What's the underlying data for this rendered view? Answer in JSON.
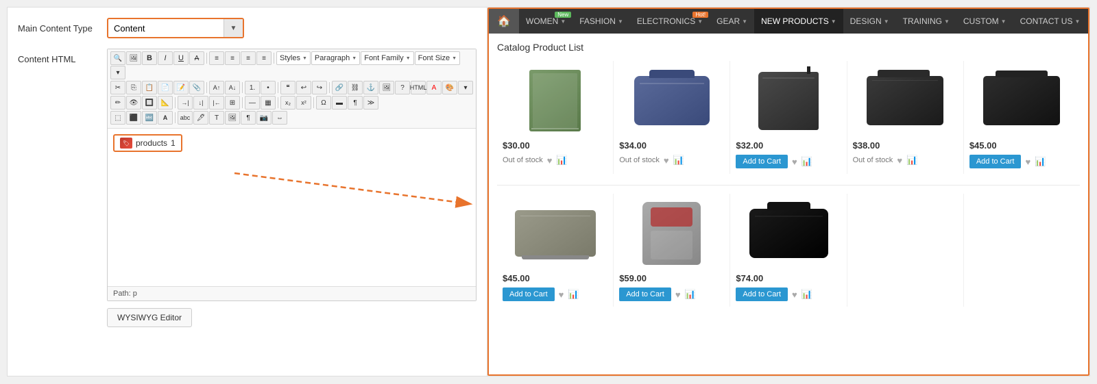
{
  "left": {
    "content_type_label": "Main Content Type",
    "content_type_value": "Content",
    "content_html_label": "Content HTML",
    "path_label": "Path: p",
    "wysiwyg_button": "WYSIWYG Editor",
    "products_widget_label": "products",
    "products_widget_count": "1",
    "toolbar": {
      "row1": {
        "styles_label": "Styles",
        "paragraph_label": "Paragraph",
        "font_family_label": "Font Family",
        "font_size_label": "Font Size"
      }
    }
  },
  "right": {
    "nav": {
      "home_icon": "🏠",
      "items": [
        {
          "label": "WOMEN",
          "badge": "New",
          "badge_type": "new",
          "has_arrow": true
        },
        {
          "label": "FASHION",
          "has_arrow": true
        },
        {
          "label": "ELECTRONICS",
          "badge": "Hot!",
          "badge_type": "hot",
          "has_arrow": true
        },
        {
          "label": "GEAR",
          "has_arrow": true
        },
        {
          "label": "NEW PRODUCTS",
          "active": true,
          "has_arrow": true
        },
        {
          "label": "DESIGN",
          "has_arrow": true
        },
        {
          "label": "TRAINING",
          "has_arrow": true
        },
        {
          "label": "CUSTOM",
          "has_arrow": true
        },
        {
          "label": "CONTACT US",
          "has_arrow": true
        }
      ]
    },
    "catalog_title": "Catalog Product List",
    "products_row1": [
      {
        "price": "$30.00",
        "status": "Out of stock",
        "has_add_to_cart": false,
        "shape": "book"
      },
      {
        "price": "$34.00",
        "status": "Out of stock",
        "has_add_to_cart": false,
        "shape": "duffel-navy"
      },
      {
        "price": "$32.00",
        "status": "",
        "has_add_to_cart": true,
        "add_to_cart_label": "Add to Cart",
        "shape": "sling"
      },
      {
        "price": "$38.00",
        "status": "Out of stock",
        "has_add_to_cart": false,
        "shape": "messenger-dark"
      },
      {
        "price": "$45.00",
        "status": "",
        "has_add_to_cart": true,
        "add_to_cart_label": "Add to Cart",
        "shape": "messenger-dark2"
      }
    ],
    "products_row2": [
      {
        "price": "$45.00",
        "status": "",
        "has_add_to_cart": true,
        "add_to_cart_label": "Add to Cart",
        "shape": "messenger-gray"
      },
      {
        "price": "$59.00",
        "status": "",
        "has_add_to_cart": true,
        "add_to_cart_label": "Add to Cart",
        "shape": "backpack-gray"
      },
      {
        "price": "$74.00",
        "status": "",
        "has_add_to_cart": true,
        "add_to_cart_label": "Add to Cart",
        "shape": "duffel-black"
      }
    ]
  }
}
